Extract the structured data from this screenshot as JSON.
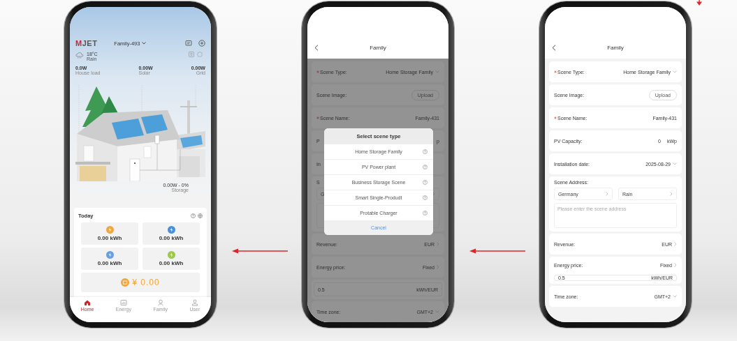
{
  "phones": [
    {
      "kind": "home",
      "logo": {
        "mark": "M",
        "text": "JET"
      },
      "family": "Family-493",
      "weather": {
        "temperature": "18°C",
        "condition": "Rain"
      },
      "readings": [
        {
          "value": "0.0W",
          "label": "House load"
        },
        {
          "value": "0.00W",
          "label": "Solar"
        },
        {
          "value": "0.00W",
          "label": "Grid"
        }
      ],
      "storage": {
        "value": "0.00W - 0%",
        "label": "Storage"
      },
      "today": {
        "title": "Today",
        "tiles": [
          {
            "value": "0.00 kWh",
            "color": "#f0a640"
          },
          {
            "value": "0.00 kWh",
            "color": "#4a90d9"
          },
          {
            "value": "0.00 kWh",
            "color": "#6a9ee0"
          },
          {
            "value": "0.00 kWh",
            "color": "#9cc94a"
          }
        ],
        "revenue": "¥ 0.00"
      },
      "nav": [
        {
          "kind": "home",
          "label": "Home",
          "selected": true
        },
        {
          "kind": "energy",
          "label": "Energy",
          "selected": false
        },
        {
          "kind": "family",
          "label": "Family",
          "selected": false
        },
        {
          "kind": "user",
          "label": "User",
          "selected": false
        }
      ]
    },
    {
      "kind": "form",
      "title": "Family",
      "rows": [
        {
          "kind": "select",
          "label": "Scene Type:",
          "required": true,
          "value": "Home Storage Family"
        },
        {
          "kind": "upload",
          "label": "Scene Image:",
          "value": "Upload"
        },
        {
          "kind": "text",
          "label": "Scene Name:",
          "required": true,
          "value": "Family-431"
        },
        {
          "kind": "text",
          "label": "P",
          "value": "p"
        },
        {
          "kind": "text",
          "label": "In"
        },
        {
          "kind": "address",
          "label": "S",
          "country": "G"
        },
        {
          "kind": "link",
          "label": "Revenue:",
          "value": "EUR"
        },
        {
          "kind": "link",
          "label": "Energy price:",
          "value": "Fixed"
        },
        {
          "kind": "input",
          "value": "0.5",
          "unit": "kWh/EUR"
        },
        {
          "kind": "select",
          "label": "Time zone:",
          "value": "GMT+2"
        }
      ],
      "modal": {
        "title": "Select scene type",
        "options": [
          "Home Storage Family",
          "PV Power plant",
          "Business Storage Scene",
          "Smart Single-Produdt",
          "Protable Charger"
        ],
        "cancel": "Cancel"
      }
    },
    {
      "kind": "form",
      "title": "Family",
      "rows": [
        {
          "kind": "select",
          "label": "Scene Type:",
          "required": true,
          "value": "Home Storage Family"
        },
        {
          "kind": "upload",
          "label": "Scene Image:",
          "value": "Upload"
        },
        {
          "kind": "text",
          "label": "Scene Name:",
          "required": true,
          "value": "Family-431"
        },
        {
          "kind": "unit",
          "label": "PV Capacity:",
          "value": "0",
          "unit": "kWp"
        },
        {
          "kind": "select",
          "label": "Installation date:",
          "value": "2025-08-29"
        },
        {
          "kind": "address",
          "label": "Scene Address:",
          "country": "Germany",
          "region": "Rain",
          "placeholder": "Please enter the scene address"
        },
        {
          "kind": "link",
          "label": "Revenue:",
          "value": "EUR"
        },
        {
          "kind": "price",
          "label": "Energy price:",
          "value": "Fixed",
          "amount": "0.5",
          "unit": "kWh/EUR"
        },
        {
          "kind": "select",
          "label": "Time zone:",
          "value": "GMT+2"
        }
      ]
    }
  ]
}
